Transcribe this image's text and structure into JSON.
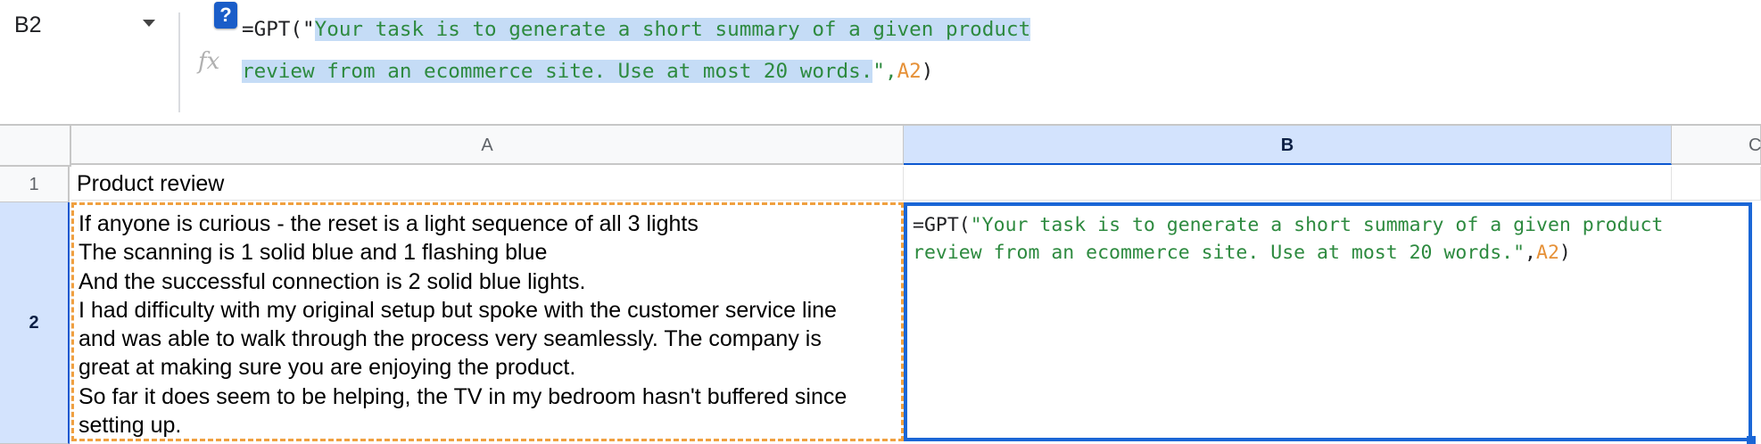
{
  "name_box": {
    "value": "B2",
    "dropdown_icon": "chevron-down-icon"
  },
  "formula_bar": {
    "fx_label": "fx",
    "help_label": "?",
    "prefix": "=GPT(\"",
    "quoted_line1": "Your task is to generate a short summary of a given product",
    "quoted_line2": "review from an ecommerce site. Use at most 20 words.",
    "close_quote": "\",",
    "ref": "A2",
    "suffix": ")"
  },
  "columns": [
    "A",
    "B",
    "C"
  ],
  "rows": [
    "1",
    "2"
  ],
  "selected_cell": "B2",
  "cells": {
    "A1": "Product review",
    "A2_lines": [
      "If anyone is curious - the reset is a light sequence of all 3 lights",
      "The scanning is 1 solid blue and 1 flashing blue",
      "And the successful connection is 2 solid blue lights.",
      "I had difficulty with my original setup but spoke with the customer service line",
      "and was able to walk through the process very seamlessly. The company is",
      "great at making sure you are enjoying the product.",
      "So far it does seem to be helping, the TV in my bedroom hasn't buffered since",
      "setting up."
    ],
    "B2": {
      "line1_prefix": "=GPT(",
      "line1_string": "\"Your task is to generate a short summary of a given product",
      "line2_string": "review from an ecommerce site. Use at most 20 words.\"",
      "comma": ",",
      "ref": "A2",
      "suffix": ")"
    }
  },
  "colors": {
    "selection_blue": "#1a66d6",
    "header_selected_bg": "#d3e3fd",
    "string_green": "#2d8a3f",
    "reference_orange": "#e69138",
    "copy_marquee_orange": "#f0a040",
    "formula_highlight": "#c5dcf6"
  }
}
